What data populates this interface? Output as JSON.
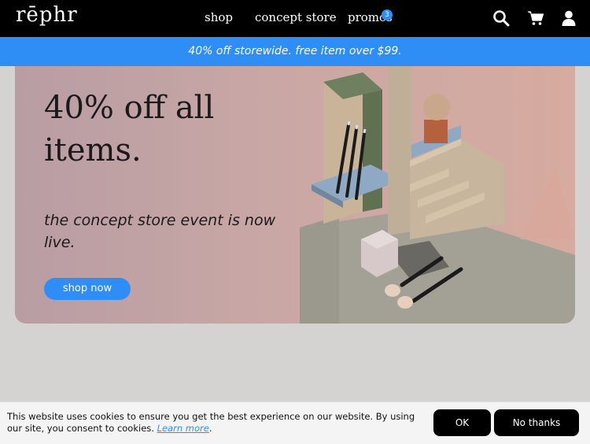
{
  "header": {
    "logo": "rēphr",
    "nav": [
      {
        "label": "shop"
      },
      {
        "label": "concept store"
      },
      {
        "label": "promos"
      }
    ],
    "promo_badge": "3",
    "icons": [
      "search-icon",
      "cart-icon",
      "user-icon"
    ]
  },
  "promo_bar": {
    "text": "40% off storewide. free item over $99."
  },
  "hero": {
    "title": "40% off all items.",
    "subtitle": "the concept store event is now live.",
    "cta": "shop now"
  },
  "cookie": {
    "text": "This website uses cookies to ensure you get the best experience on our website. By using our site, you consent to cookies.",
    "learn_more": "Learn more",
    "ok": "OK",
    "no_thanks": "No thanks"
  },
  "colors": {
    "accent": "#2f8ef5",
    "nav_bg": "#000000",
    "page_bg": "#d4d3d1",
    "hero_bg": "#c9a7a5"
  }
}
